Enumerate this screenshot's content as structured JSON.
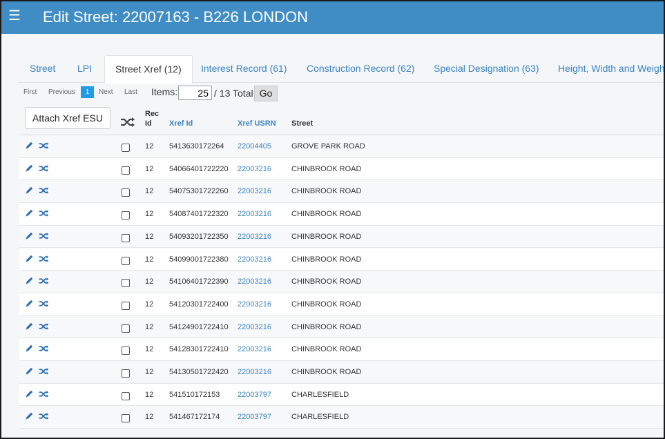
{
  "header": {
    "menu_icon": "hamburger-icon",
    "title": "Edit Street: 22007163 - B226 LONDON",
    "bg_color": "#3f8dc4"
  },
  "tabs": [
    {
      "label": "Street",
      "active": false
    },
    {
      "label": "LPI",
      "active": false
    },
    {
      "label": "Street Xref (12)",
      "active": true
    },
    {
      "label": "Interest Record (61)",
      "active": false
    },
    {
      "label": "Construction Record (62)",
      "active": false
    },
    {
      "label": "Special Designation (63)",
      "active": false
    },
    {
      "label": "Height, Width and Weight",
      "active": false
    }
  ],
  "pager": {
    "first": "First",
    "previous": "Previous",
    "current": "1",
    "next": "Next",
    "last": "Last",
    "items_label": "Items:",
    "items_value": "25",
    "total": "/ 13 Total",
    "go": "Go"
  },
  "table": {
    "attach_button": "Attach Xref ESU",
    "columns": {
      "rec_id": "Rec Id",
      "xref_id": "Xref Id",
      "xref_usrn": "Xref USRN",
      "street": "Street"
    },
    "rows": [
      {
        "rec_id": "12",
        "xref_id": "5413630172264",
        "xref_usrn": "22004405",
        "street": "GROVE PARK ROAD"
      },
      {
        "rec_id": "12",
        "xref_id": "54066401722220",
        "xref_usrn": "22003216",
        "street": "CHINBROOK ROAD"
      },
      {
        "rec_id": "12",
        "xref_id": "54075301722260",
        "xref_usrn": "22003216",
        "street": "CHINBROOK ROAD"
      },
      {
        "rec_id": "12",
        "xref_id": "54087401722320",
        "xref_usrn": "22003216",
        "street": "CHINBROOK ROAD"
      },
      {
        "rec_id": "12",
        "xref_id": "54093201722350",
        "xref_usrn": "22003216",
        "street": "CHINBROOK ROAD"
      },
      {
        "rec_id": "12",
        "xref_id": "54099001722380",
        "xref_usrn": "22003216",
        "street": "CHINBROOK ROAD"
      },
      {
        "rec_id": "12",
        "xref_id": "54106401722390",
        "xref_usrn": "22003216",
        "street": "CHINBROOK ROAD"
      },
      {
        "rec_id": "12",
        "xref_id": "54120301722400",
        "xref_usrn": "22003216",
        "street": "CHINBROOK ROAD"
      },
      {
        "rec_id": "12",
        "xref_id": "54124901722410",
        "xref_usrn": "22003216",
        "street": "CHINBROOK ROAD"
      },
      {
        "rec_id": "12",
        "xref_id": "54128301722410",
        "xref_usrn": "22003216",
        "street": "CHINBROOK ROAD"
      },
      {
        "rec_id": "12",
        "xref_id": "54130501722420",
        "xref_usrn": "22003216",
        "street": "CHINBROOK ROAD"
      },
      {
        "rec_id": "12",
        "xref_id": "541510172153",
        "xref_usrn": "22003797",
        "street": "CHARLESFIELD"
      },
      {
        "rec_id": "12",
        "xref_id": "541467172174",
        "xref_usrn": "22003797",
        "street": "CHARLESFIELD"
      }
    ]
  },
  "icons": {
    "edit": "pencil-icon",
    "shuffle": "shuffle-icon",
    "checkbox": "checkbox"
  },
  "colors": {
    "link": "#3a83c2",
    "pager_active": "#1e9be9"
  }
}
